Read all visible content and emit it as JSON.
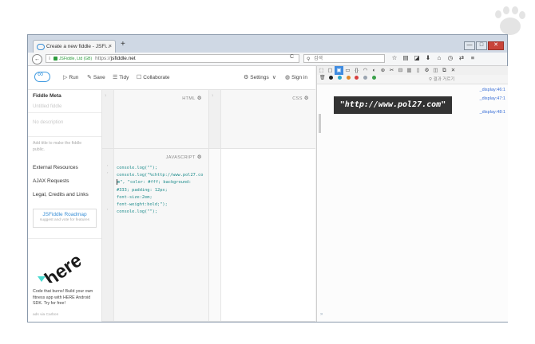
{
  "browser": {
    "tab_title": "Create a new fiddle - JSFi...",
    "tab_close": "×",
    "new_tab": "+",
    "window_buttons": [
      "—",
      "□",
      "✕"
    ],
    "url": {
      "info": "i",
      "company": "JSFiddle, Ltd (GB)",
      "protocol": "https://",
      "host": "jsfiddle.net"
    },
    "reload": "C",
    "search_placeholder": "검색",
    "nav_icons": [
      "star-icon",
      "reading-list-icon",
      "pocket-icon",
      "download-icon",
      "home-icon",
      "history-icon",
      "sync-icon",
      "menu-icon"
    ]
  },
  "jsfiddle": {
    "toolbar": {
      "run": "Run",
      "save": "Save",
      "tidy": "Tidy",
      "collaborate": "Collaborate",
      "settings": "Settings",
      "signin": "Sign in"
    },
    "sidebar": {
      "title": "Fiddle Meta",
      "title_placeholder": "Untitled fiddle",
      "description_placeholder": "No description",
      "help": "Add title to make the fiddle public.",
      "links": [
        "External Resources",
        "AJAX Requests",
        "Legal, Credits and Links"
      ],
      "roadmap_title": "JSFiddle Roadmap",
      "roadmap_sub": "suggest and vote for features",
      "ad_brand": "here",
      "ad_text": "Code that burns! Build your own fitness app with HERE Android SDK. Try for free!",
      "ad_via": "ads via Carbon"
    },
    "panels": {
      "html_label": "HTML",
      "css_label": "CSS",
      "js_label": "JAVASCRIPT"
    },
    "js_code": {
      "line1": "console.log(\"\");",
      "line2": "console.log(\"%chttp://www.pol27.co",
      "line3": "m\", \"color: #fff; background:",
      "line4": "#333; padding: 12px;",
      "line5": "font-size:2em;",
      "line6": "font-weight:bold;\");",
      "line7": "console.log(\"\");"
    }
  },
  "devtools": {
    "filter_placeholder": "결과 거르기",
    "console_output": "\"http://www.pol27.com\"",
    "source_links": [
      "_display:46:1",
      "_display:47:1",
      "_display:48:1"
    ],
    "prompt": "»"
  },
  "colors": {
    "accent": "#3f9ae0",
    "banner_bg": "#333333",
    "banner_fg": "#ffffff",
    "code_teal": "#1a8a8a"
  }
}
